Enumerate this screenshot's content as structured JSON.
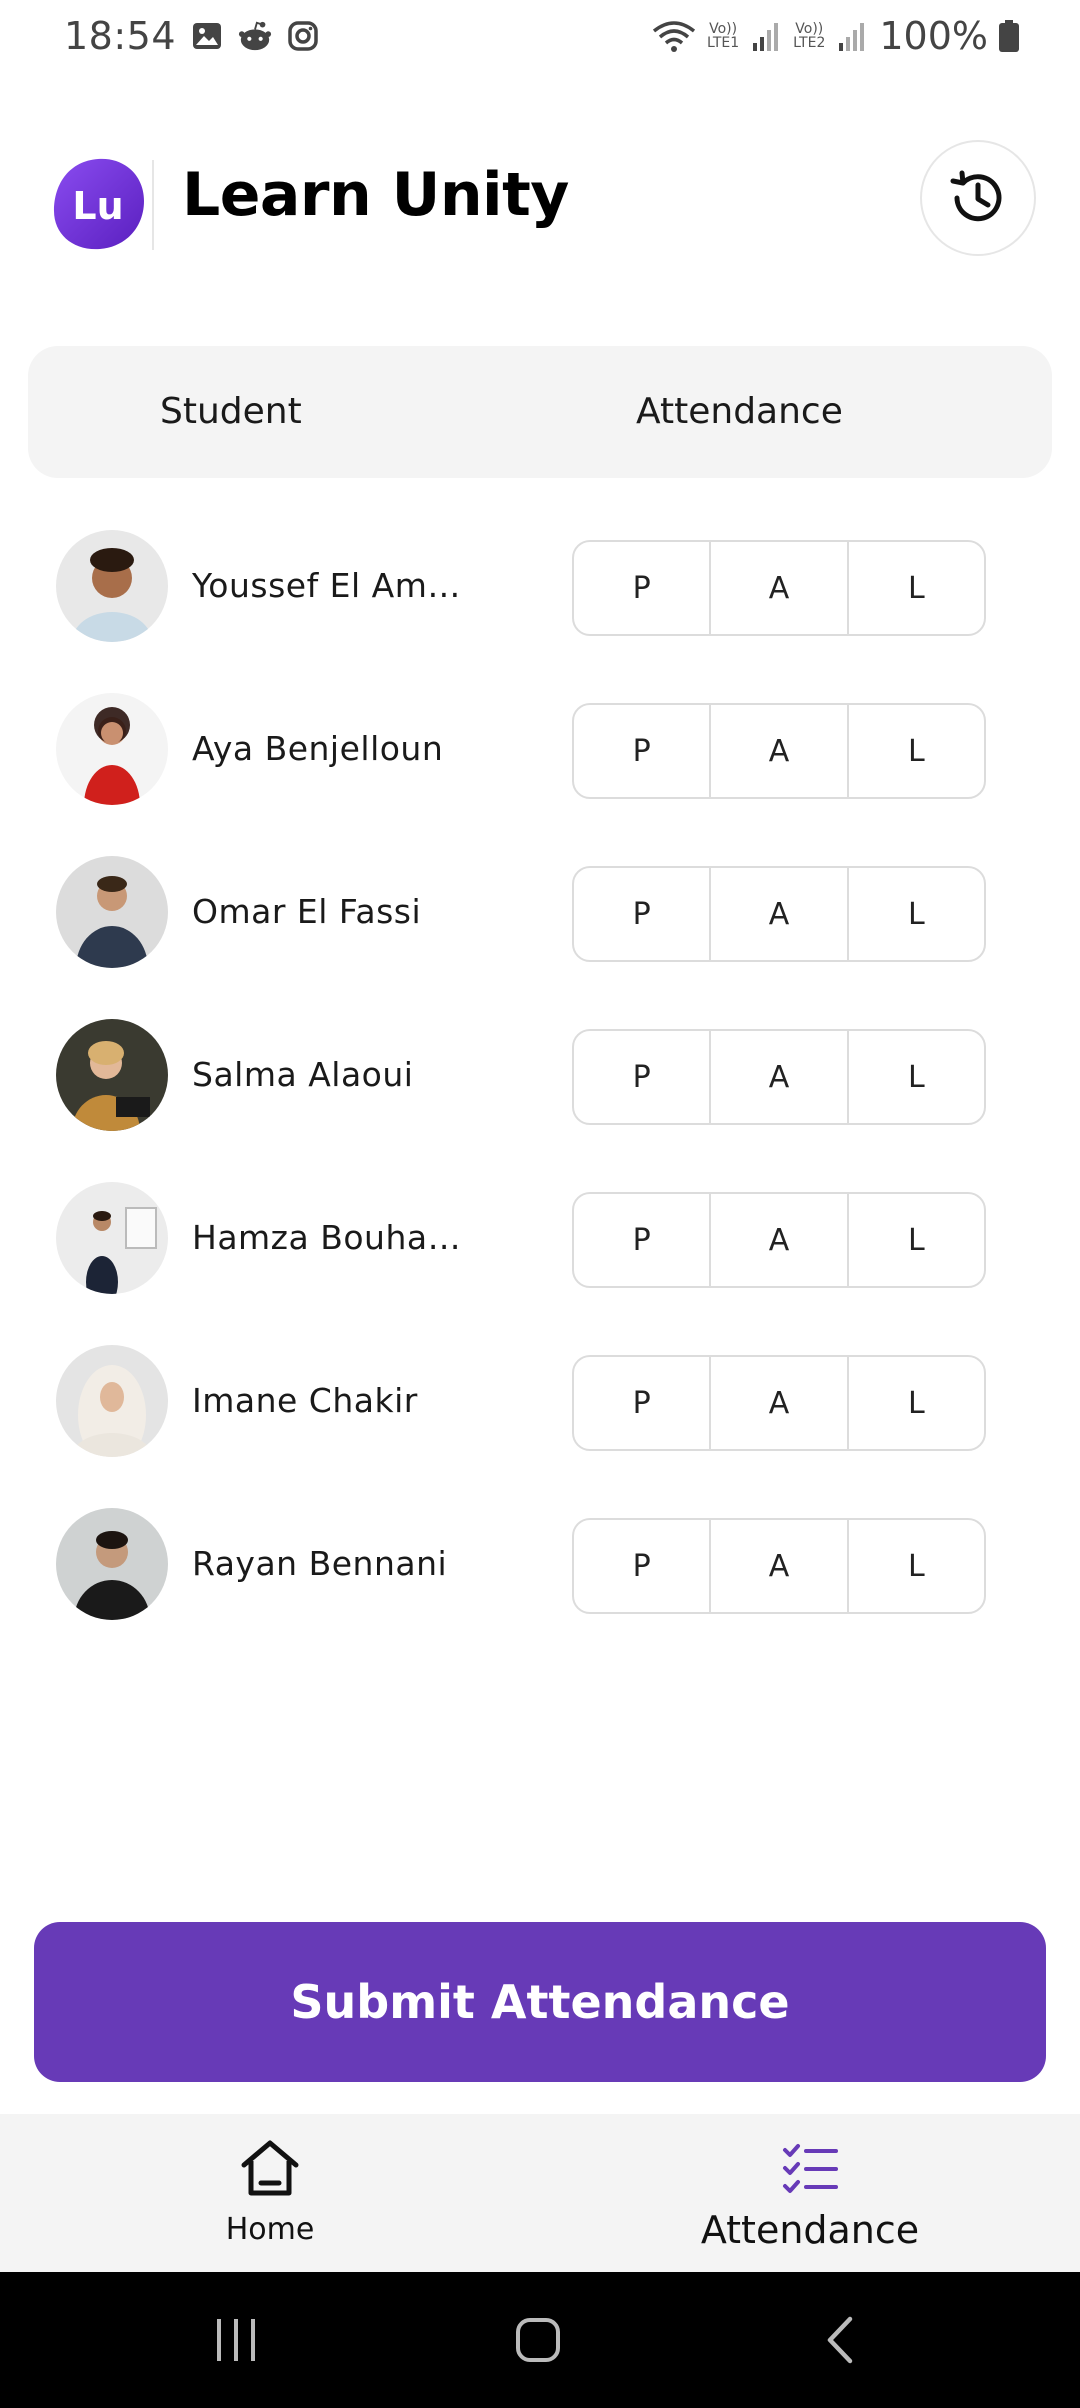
{
  "status_bar": {
    "time": "18:54",
    "battery_text": "100%",
    "sim1_label": "LTE1",
    "sim2_label": "LTE2",
    "volte_label": "Vo))",
    "icons": [
      "image-icon",
      "reddit-icon",
      "instagram-icon",
      "wifi-icon",
      "signal-icon",
      "battery-icon"
    ]
  },
  "header": {
    "logo_text": "Lu",
    "title": "Learn Unity",
    "history_icon": "history-icon"
  },
  "table": {
    "col_student": "Student",
    "col_attendance": "Attendance"
  },
  "students": [
    {
      "name": "Youssef El Am…",
      "options": [
        "P",
        "A",
        "L"
      ]
    },
    {
      "name": "Aya Benjelloun",
      "options": [
        "P",
        "A",
        "L"
      ]
    },
    {
      "name": "Omar El Fassi",
      "options": [
        "P",
        "A",
        "L"
      ]
    },
    {
      "name": "Salma Alaoui",
      "options": [
        "P",
        "A",
        "L"
      ]
    },
    {
      "name": "Hamza Bouha…",
      "options": [
        "P",
        "A",
        "L"
      ]
    },
    {
      "name": "Imane Chakir",
      "options": [
        "P",
        "A",
        "L"
      ]
    },
    {
      "name": "Rayan Bennani",
      "options": [
        "P",
        "A",
        "L"
      ]
    }
  ],
  "submit_label": "Submit Attendance",
  "bottom_nav": {
    "home_label": "Home",
    "attendance_label": "Attendance"
  },
  "colors": {
    "accent": "#673ab7",
    "logo_gradient_start": "#7b3fe4",
    "logo_gradient_end": "#5b22c0",
    "nav_background": "#f4f4f4"
  }
}
